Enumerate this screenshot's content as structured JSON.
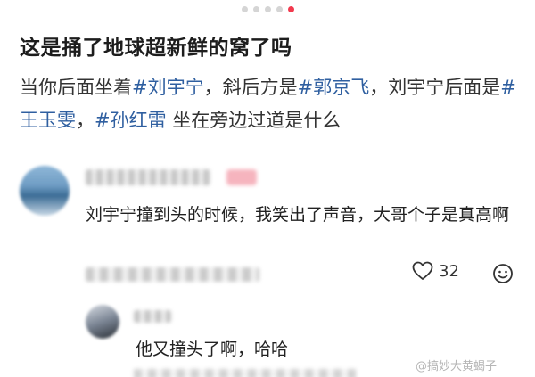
{
  "pager": {
    "count": 5,
    "active": 4,
    "active_color": "#f23a4e"
  },
  "post": {
    "title": "这是捅了地球超新鲜的窝了吗",
    "seg1": "当你后面坐着",
    "tag1": "#刘宇宁",
    "seg2": "，斜后方是",
    "tag2": "#郭京飞",
    "seg3": "，刘宇宁后面是",
    "tag3": "#王玉雯",
    "seg4": "，",
    "tag4": "#孙红雷",
    "seg5": " 坐在旁边过道是什么",
    "tag_color": "#2f5fa0"
  },
  "comment": {
    "text": "刘宇宁撞到头的时候，我笑出了声音，大哥个子是真高啊",
    "like_count": "32"
  },
  "reply": {
    "text": "他又撞头了啊，哈哈"
  },
  "watermark": "@搞妙大黄蝎子"
}
